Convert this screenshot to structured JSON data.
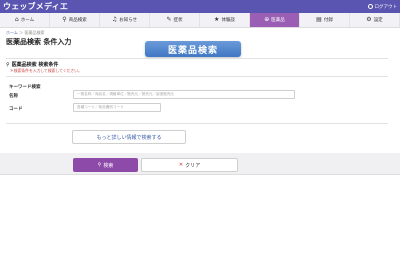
{
  "header": {
    "logo": "ウェッブメディエ",
    "logout": "ログアウト"
  },
  "nav": [
    {
      "label": "ホーム",
      "icon": "home-icon",
      "glyph": "⌂",
      "active": false
    },
    {
      "label": "商品検索",
      "icon": "search-icon",
      "glyph": "⚲",
      "active": false
    },
    {
      "label": "お知らせ",
      "icon": "bell-icon",
      "glyph": "♫",
      "active": false
    },
    {
      "label": "症状",
      "icon": "pencil-icon",
      "glyph": "✎",
      "active": false
    },
    {
      "label": "体験談",
      "icon": "star-icon",
      "glyph": "★",
      "active": false
    },
    {
      "label": "医薬品",
      "icon": "plus-circle-icon",
      "glyph": "⊕",
      "active": true
    },
    {
      "label": "付録",
      "icon": "document-icon",
      "glyph": "▤",
      "active": false
    },
    {
      "label": "設定",
      "icon": "gear-icon",
      "glyph": "⚙",
      "active": false
    }
  ],
  "breadcrumb": {
    "home": "ホーム",
    "sep": "＞",
    "current": "医薬品検索"
  },
  "page_title": "医薬品検索 条件入力",
  "banner": "医薬品検索",
  "conditions": {
    "title": "医薬品検索 検索条件",
    "note": "＊検索条件を入力して検索してください。"
  },
  "form": {
    "keyword_label": "キーワード検索",
    "name_label": "名称",
    "name_placeholder": "一般名称／商品名／規格単位／販売元／発売元／製造販売元",
    "code_label": "コード",
    "code_placeholder": "各種コード／商品識別コード",
    "more_button": "もっと詳しい情報で検索する"
  },
  "actions": {
    "search": "検索",
    "clear": "クリア"
  }
}
